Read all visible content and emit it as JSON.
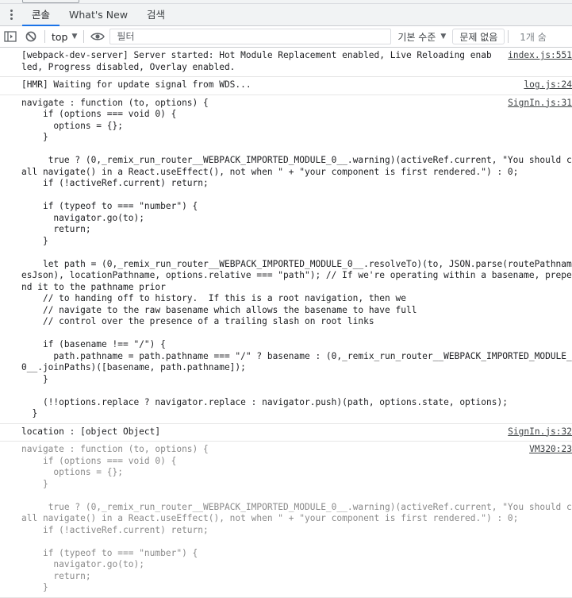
{
  "window_fragment": "",
  "tabs": [
    {
      "label": "콘솔",
      "active": true
    },
    {
      "label": "What's New",
      "active": false
    },
    {
      "label": "검색",
      "active": false
    }
  ],
  "toolbar": {
    "context": "top",
    "filter_placeholder": "필터",
    "levels_label": "기본 수준",
    "issues_label": "문제 없음",
    "hidden_count": "1개 숨"
  },
  "icons": {
    "sidebar": "sidebar-toggle-icon",
    "clear": "clear-console-icon",
    "eye": "live-expression-eye-icon",
    "more": "more-vertical-icon"
  },
  "colors": {
    "accent": "#1a73e8",
    "border": "#cbcdd1",
    "dim_text": "#808080"
  },
  "messages": [
    {
      "text": "[webpack-dev-server] Server started: Hot Module Replacement enabled, Live Reloading enabled, Progress disabled, Overlay enabled.",
      "source": "index.js:551"
    },
    {
      "text": "[HMR] Waiting for update signal from WDS...",
      "source": "log.js:24"
    },
    {
      "text": "navigate : function (to, options) {\n    if (options === void 0) {\n      options = {};\n    }\n\n     true ? (0,_remix_run_router__WEBPACK_IMPORTED_MODULE_0__.warning)(activeRef.current, \"You should call navigate() in a React.useEffect(), not when \" + \"your component is first rendered.\") : 0;\n    if (!activeRef.current) return;\n\n    if (typeof to === \"number\") {\n      navigator.go(to);\n      return;\n    }\n\n    let path = (0,_remix_run_router__WEBPACK_IMPORTED_MODULE_0__.resolveTo)(to, JSON.parse(routePathnamesJson), locationPathname, options.relative === \"path\"); // If we're operating within a basename, prepend it to the pathname prior\n    // to handing off to history.  If this is a root navigation, then we\n    // navigate to the raw basename which allows the basename to have full\n    // control over the presence of a trailing slash on root links\n\n    if (basename !== \"/\") {\n      path.pathname = path.pathname === \"/\" ? basename : (0,_remix_run_router__WEBPACK_IMPORTED_MODULE_0__.joinPaths)([basename, path.pathname]);\n    }\n\n    (!!options.replace ? navigator.replace : navigator.push)(path, options.state, options);\n  }",
      "source": "SignIn.js:31"
    },
    {
      "text": "location : [object Object]",
      "source": "SignIn.js:32"
    },
    {
      "text": "navigate : function (to, options) {\n    if (options === void 0) {\n      options = {};\n    }\n\n     true ? (0,_remix_run_router__WEBPACK_IMPORTED_MODULE_0__.warning)(activeRef.current, \"You should call navigate() in a React.useEffect(), not when \" + \"your component is first rendered.\") : 0;\n    if (!activeRef.current) return;\n\n    if (typeof to === \"number\") {\n      navigator.go(to);\n      return;\n    }",
      "source": "VM320:23"
    }
  ]
}
